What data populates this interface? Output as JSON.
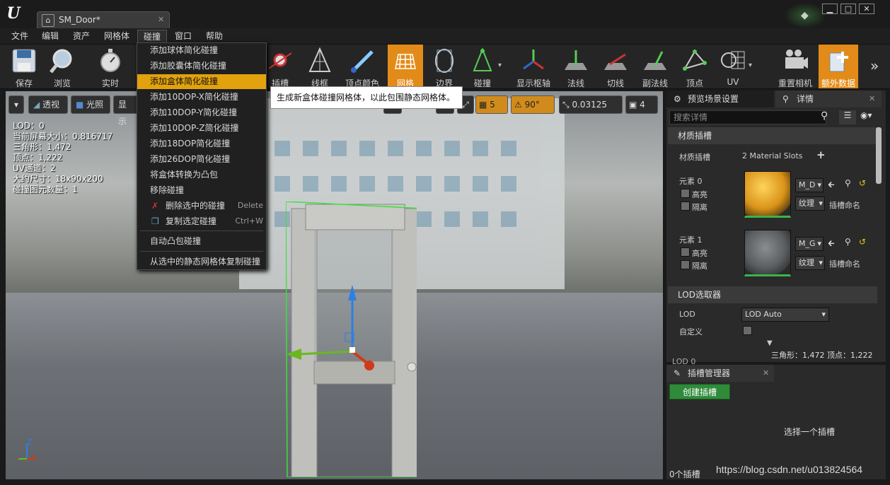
{
  "titlebar": {
    "tab_title": "SM_Door*",
    "win_buttons": {
      "minimize": "▁",
      "maximize": "□",
      "close": "✕"
    }
  },
  "menubar": {
    "items": [
      "文件",
      "编辑",
      "资产",
      "网格体",
      "碰撞",
      "窗口",
      "帮助"
    ],
    "open": "碰撞"
  },
  "toolbar": {
    "buttons": [
      "保存",
      "浏览",
      "实时",
      "插槽",
      "线框",
      "顶点颜色",
      "网格",
      "边界",
      "碰撞",
      "显示枢轴",
      "法线",
      "切线",
      "副法线",
      "顶点",
      "UV",
      "重置相机",
      "额外数据"
    ],
    "active": [
      "网格",
      "额外数据"
    ]
  },
  "collision_menu": {
    "items": [
      {
        "label": "添加球体简化碰撞",
        "shortcut": ""
      },
      {
        "label": "添加胶囊体简化碰撞",
        "shortcut": ""
      },
      {
        "label": "添加盒体简化碰撞",
        "shortcut": ""
      },
      {
        "label": "添加10DOP-X简化碰撞",
        "shortcut": ""
      },
      {
        "label": "添加10DOP-Y简化碰撞",
        "shortcut": ""
      },
      {
        "label": "添加10DOP-Z简化碰撞",
        "shortcut": ""
      },
      {
        "label": "添加18DOP简化碰撞",
        "shortcut": ""
      },
      {
        "label": "添加26DOP简化碰撞",
        "shortcut": ""
      },
      {
        "label": "将盒体转换为凸包",
        "shortcut": ""
      },
      {
        "label": "移除碰撞",
        "shortcut": ""
      },
      {
        "label": "删除选中的碰撞",
        "shortcut": "Delete"
      },
      {
        "label": "复制选定碰撞",
        "shortcut": "Ctrl+W"
      },
      {
        "label": "自动凸包碰撞",
        "shortcut": ""
      },
      {
        "label": "从选中的静态网格体复制碰撞",
        "shortcut": ""
      }
    ],
    "highlighted": "添加盒体简化碰撞",
    "tooltip": "生成新盒体碰撞网格体，以此包围静态网格体。"
  },
  "viewport": {
    "view_mode": "透视",
    "lighting": "光照",
    "show": "显示",
    "grid_snap": "5",
    "rotation_snap": "90°",
    "scale_snap": "0.03125",
    "camera_speed": "4",
    "stats": [
      "LOD：0",
      "当前屏幕大小：0.816717",
      "三角形：1,472",
      "顶点：1,222",
      "UV通道：2",
      "大约尺寸：18x90x200",
      "碰撞图元数量：1"
    ],
    "axis_labels": {
      "z": "Z",
      "x": "X"
    }
  },
  "details": {
    "tabs": [
      "预览场景设置",
      "详情"
    ],
    "search_placeholder": "搜索详情",
    "material_section": "材质插槽",
    "material_slots_label": "材质插槽",
    "material_slots_value": "2 Material Slots",
    "elements": [
      {
        "name": "元素 0",
        "highlight": "高亮",
        "isolate": "隔离",
        "material": "M_D",
        "texture": "纹理",
        "slot_name": "插槽命名"
      },
      {
        "name": "元素 1",
        "highlight": "高亮",
        "isolate": "隔离",
        "material": "M_G",
        "texture": "纹理",
        "slot_name": "插槽命名"
      }
    ],
    "lod_section": "LOD选取器",
    "lod_label": "LOD",
    "lod_value": "LOD Auto",
    "custom_label": "自定义",
    "lod0_partial": "LOD 0",
    "footer": "三角形：1,472    顶点：1,222"
  },
  "sockets": {
    "title": "插槽管理器",
    "create_button": "创建插槽",
    "empty_text": "选择一个插槽",
    "count": "0个插槽"
  },
  "watermark": "https://blog.csdn.net/u013824564",
  "colors": {
    "accent": "#e38b18",
    "menu_highlight": "#e1a20d",
    "green": "#2f8b3a"
  }
}
